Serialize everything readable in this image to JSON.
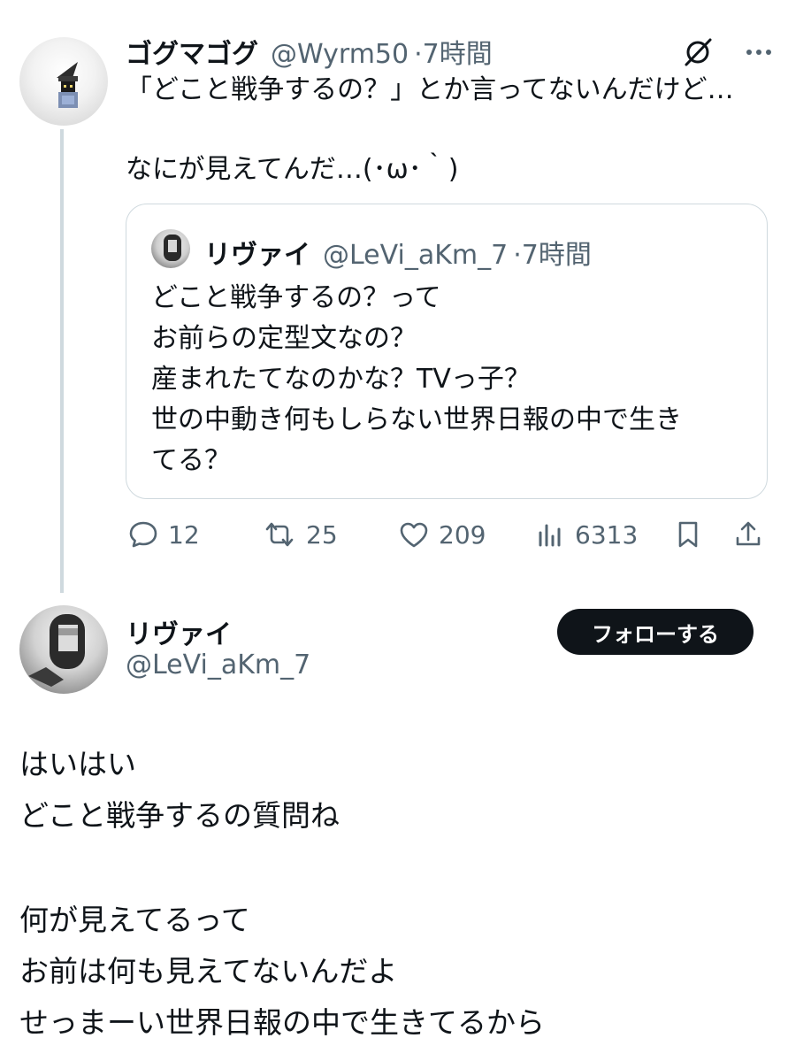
{
  "tweet": {
    "author_name": "ゴグマゴグ",
    "handle": "@Wyrm50",
    "time": "·7時間",
    "lines": [
      "「どこと戦争するの？」とか言ってないんだけど…",
      "",
      "なにが見えてんだ…(･ω･｀)"
    ],
    "quote": {
      "author_name": "リヴァイ",
      "handle": "@LeVi_aKm_7",
      "time": "·7時間",
      "lines": [
        "どこと戦争するの？って",
        "お前らの定型文なの？",
        "産まれたてなのかな？TVっ子？",
        "世の中動き何もしらない世界日報の中で生き",
        "てる？"
      ]
    },
    "actions": {
      "reply_count": "12",
      "retweet_count": "25",
      "like_count": "209",
      "view_count": "6313"
    }
  },
  "reply": {
    "author_name": "リヴァイ",
    "handle": "@LeVi_aKm_7",
    "follow_label": "フォローする",
    "lines": [
      "はいはい",
      "どこと戦争するの質問ね",
      "",
      "何が見えてるって",
      "お前は何も見えてないんだよ",
      "せっまーい世界日報の中で生きてるから"
    ]
  },
  "icons": [
    "grok-icon",
    "more-icon",
    "reply-icon",
    "retweet-icon",
    "like-icon",
    "views-icon",
    "bookmark-icon",
    "share-icon"
  ]
}
